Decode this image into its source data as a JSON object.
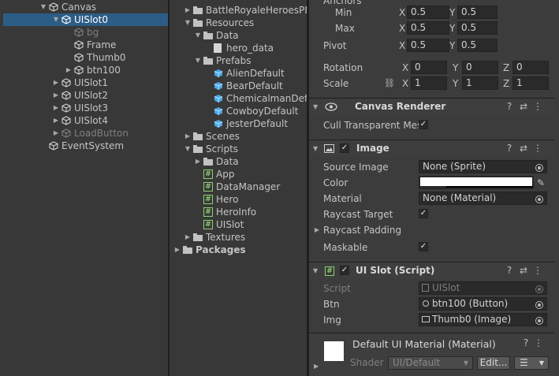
{
  "hierarchy": {
    "items": [
      {
        "label": "Canvas",
        "depth": 0,
        "arrow": "down",
        "selected": false,
        "dim": false
      },
      {
        "label": "UISlot0",
        "depth": 1,
        "arrow": "down",
        "selected": true,
        "dim": false
      },
      {
        "label": "bg",
        "depth": 2,
        "arrow": "",
        "selected": false,
        "dim": true
      },
      {
        "label": "Frame",
        "depth": 2,
        "arrow": "",
        "selected": false,
        "dim": false
      },
      {
        "label": "Thumb0",
        "depth": 2,
        "arrow": "",
        "selected": false,
        "dim": false
      },
      {
        "label": "btn100",
        "depth": 2,
        "arrow": "right",
        "selected": false,
        "dim": false
      },
      {
        "label": "UISlot1",
        "depth": 1,
        "arrow": "right",
        "selected": false,
        "dim": false
      },
      {
        "label": "UISlot2",
        "depth": 1,
        "arrow": "right",
        "selected": false,
        "dim": false
      },
      {
        "label": "UISlot3",
        "depth": 1,
        "arrow": "right",
        "selected": false,
        "dim": false
      },
      {
        "label": "UISlot4",
        "depth": 1,
        "arrow": "right",
        "selected": false,
        "dim": false
      },
      {
        "label": "LoadButton",
        "depth": 1,
        "arrow": "right",
        "selected": false,
        "dim": true
      },
      {
        "label": "EventSystem",
        "depth": 0,
        "arrow": "",
        "selected": false,
        "dim": false
      }
    ]
  },
  "project": {
    "items": [
      {
        "label": "BattleRoyaleHeroesPE",
        "depth": 1,
        "arrow": "right",
        "type": "folder"
      },
      {
        "label": "Resources",
        "depth": 1,
        "arrow": "down",
        "type": "folder"
      },
      {
        "label": "Data",
        "depth": 2,
        "arrow": "down",
        "type": "folder"
      },
      {
        "label": "hero_data",
        "depth": 3,
        "arrow": "",
        "type": "file"
      },
      {
        "label": "Prefabs",
        "depth": 2,
        "arrow": "down",
        "type": "folder"
      },
      {
        "label": "AlienDefault",
        "depth": 3,
        "arrow": "",
        "type": "prefab"
      },
      {
        "label": "BearDefault",
        "depth": 3,
        "arrow": "",
        "type": "prefab"
      },
      {
        "label": "ChemicalmanDef",
        "depth": 3,
        "arrow": "",
        "type": "prefab"
      },
      {
        "label": "CowboyDefault",
        "depth": 3,
        "arrow": "",
        "type": "prefab"
      },
      {
        "label": "JesterDefault",
        "depth": 3,
        "arrow": "",
        "type": "prefab"
      },
      {
        "label": "Scenes",
        "depth": 1,
        "arrow": "right",
        "type": "folder"
      },
      {
        "label": "Scripts",
        "depth": 1,
        "arrow": "down",
        "type": "folder"
      },
      {
        "label": "Data",
        "depth": 2,
        "arrow": "right",
        "type": "folder"
      },
      {
        "label": "App",
        "depth": 2,
        "arrow": "",
        "type": "script"
      },
      {
        "label": "DataManager",
        "depth": 2,
        "arrow": "",
        "type": "script"
      },
      {
        "label": "Hero",
        "depth": 2,
        "arrow": "",
        "type": "script"
      },
      {
        "label": "HeroInfo",
        "depth": 2,
        "arrow": "",
        "type": "script"
      },
      {
        "label": "UISlot",
        "depth": 2,
        "arrow": "",
        "type": "script"
      },
      {
        "label": "Textures",
        "depth": 1,
        "arrow": "right",
        "type": "folder"
      },
      {
        "label": "Packages",
        "depth": 0,
        "arrow": "right",
        "type": "folder"
      }
    ]
  },
  "inspector": {
    "anchors": {
      "title": "Anchors",
      "min_label": "Min",
      "min_x": "0.5",
      "min_y": "0.5",
      "max_label": "Max",
      "max_x": "0.5",
      "max_y": "0.5"
    },
    "pivot": {
      "label": "Pivot",
      "x": "0.5",
      "y": "0.5"
    },
    "rotation": {
      "label": "Rotation",
      "x": "0",
      "y": "0",
      "z": "0"
    },
    "scale": {
      "label": "Scale",
      "x": "1",
      "y": "1",
      "z": "1"
    },
    "axis": {
      "x": "X",
      "y": "Y",
      "z": "Z"
    },
    "canvas_renderer": {
      "title": "Canvas Renderer",
      "cull_label": "Cull Transparent Mes",
      "cull_checked": true
    },
    "image": {
      "title": "Image",
      "source_label": "Source Image",
      "source_value": "None (Sprite)",
      "color_label": "Color",
      "color_value": "#ffffff",
      "material_label": "Material",
      "material_value": "None (Material)",
      "raycast_target_label": "Raycast Target",
      "raycast_padding_label": "Raycast Padding",
      "maskable_label": "Maskable"
    },
    "uislot": {
      "title": "UI Slot (Script)",
      "script_label": "Script",
      "script_value": "UISlot",
      "btn_label": "Btn",
      "btn_value": "btn100 (Button)",
      "img_label": "Img",
      "img_value": "Thumb0 (Image)"
    },
    "material": {
      "title": "Default UI Material (Material)",
      "shader_label": "Shader",
      "shader_value": "UI/Default",
      "edit_label": "Edit..."
    },
    "check_glyph": "✓"
  }
}
